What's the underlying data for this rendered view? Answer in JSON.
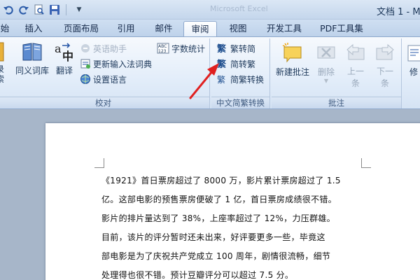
{
  "title": {
    "faded": "Microsoft Excel",
    "document": "文档 1 - M"
  },
  "qat": {
    "icons": [
      "undo-icon",
      "redo-icon",
      "print-preview-icon",
      "save-icon",
      "customize-arrow"
    ]
  },
  "tabs": [
    {
      "label": "始",
      "active": false
    },
    {
      "label": "插入",
      "active": false
    },
    {
      "label": "页面布局",
      "active": false
    },
    {
      "label": "引用",
      "active": false
    },
    {
      "label": "邮件",
      "active": false
    },
    {
      "label": "审阅",
      "active": true
    },
    {
      "label": "视图",
      "active": false
    },
    {
      "label": "开发工具",
      "active": false
    },
    {
      "label": "PDF工具集",
      "active": false
    }
  ],
  "ribbon": {
    "proofing": {
      "label": "校对",
      "partial_label": "录索",
      "thesaurus": "同义词库",
      "translate": "翻译",
      "english_assistant": "英语助手",
      "update_ime": "更新输入法词典",
      "set_language": "设置语言",
      "word_count": "字数统计"
    },
    "chinese_conversion": {
      "label": "中文简繁转换",
      "to_simplified": "繁转简",
      "to_traditional": "简转繁",
      "convert": "简繁转换"
    },
    "comments": {
      "label": "批注",
      "new": "新建批注",
      "delete": "删除",
      "previous": "上一条",
      "next": "下一条"
    },
    "partial_next_group": "修"
  },
  "document": {
    "lines": [
      "《1921》首日票房超过了 8000 万，影片累计票房超过了 1.5",
      "亿。这部电影的预售票房便破了 1 亿，首日票房成绩很不错。",
      "影片的排片量达到了 38%，上座率超过了 12%，力压群雄。",
      "目前，该片的评分暂时还未出来，好评要更多一些，毕竟这",
      "部电影是为了庆祝共产党成立 100 周年，剧情很流畅，细节",
      "处理得也很不错。预计豆瓣评分可以超过 7.5 分。"
    ]
  },
  "colors": {
    "accent_arrow": "#e02020",
    "ribbon_text": "#1e395b"
  }
}
